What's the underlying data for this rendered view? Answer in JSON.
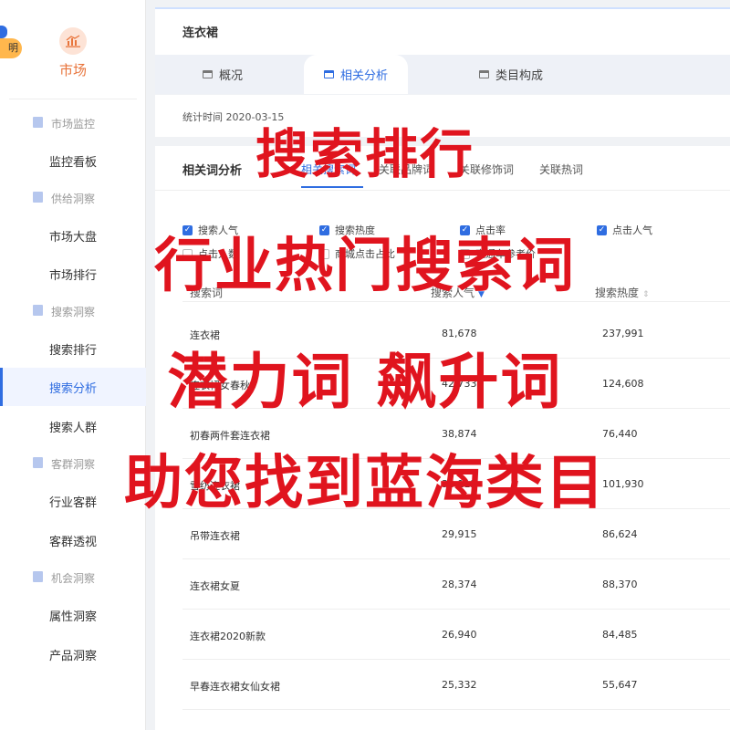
{
  "sidebar": {
    "corner_badge": "明",
    "brand_label": "市场",
    "groups": [
      {
        "label": "市场监控",
        "items": [
          "监控看板"
        ]
      },
      {
        "label": "供给洞察",
        "items": [
          "市场大盘",
          "市场排行"
        ]
      },
      {
        "label": "搜索洞察",
        "items": [
          "搜索排行",
          "搜索分析",
          "搜索人群"
        ]
      },
      {
        "label": "客群洞察",
        "items": [
          "行业客群",
          "客群透视"
        ]
      },
      {
        "label": "机会洞察",
        "items": [
          "属性洞察",
          "产品洞察"
        ]
      }
    ],
    "active_item": "搜索分析"
  },
  "header": {
    "title": "连衣裙",
    "tabs": [
      "概况",
      "相关分析",
      "类目构成"
    ],
    "active_tab": "相关分析",
    "stat_time": "统计时间 2020-03-15"
  },
  "content": {
    "sub_title": "相关词分析",
    "subtabs": [
      "相关搜索词",
      "关联品牌词",
      "关联修饰词",
      "关联热词"
    ],
    "active_subtab": "相关搜索词",
    "checkboxes": [
      {
        "label": "搜索人气",
        "checked": true
      },
      {
        "label": "搜索热度",
        "checked": true
      },
      {
        "label": "点击率",
        "checked": true
      },
      {
        "label": "点击人气",
        "checked": true
      },
      {
        "label": "点击人数",
        "checked": false
      },
      {
        "label": "商城点击占比",
        "checked": false
      },
      {
        "label": "直通车参考价",
        "checked": false
      }
    ],
    "columns": [
      "搜索词",
      "搜索人气",
      "搜索热度"
    ],
    "rows": [
      [
        "连衣裙",
        "81,678",
        "237,991"
      ],
      [
        "连衣裙女春秋",
        "42,733",
        "124,608"
      ],
      [
        "初春两件套连衣裙",
        "38,874",
        "76,440"
      ],
      [
        "雪纺连衣裙",
        "34,112",
        "101,930"
      ],
      [
        "吊带连衣裙",
        "29,915",
        "86,624"
      ],
      [
        "连衣裙女夏",
        "28,374",
        "88,370"
      ],
      [
        "连衣裙2020新款",
        "26,940",
        "84,485"
      ],
      [
        "早春连衣裙女仙女裙",
        "25,332",
        "55,647"
      ]
    ]
  },
  "overlay": {
    "line1": "搜索排行",
    "line2": "行业热门搜索词",
    "line3": "潜力词 飙升词",
    "line4": "助您找到蓝海类目"
  },
  "colors": {
    "accent": "#2f6de1",
    "brand": "#e8743b",
    "overlay_red": "#e0141e"
  }
}
